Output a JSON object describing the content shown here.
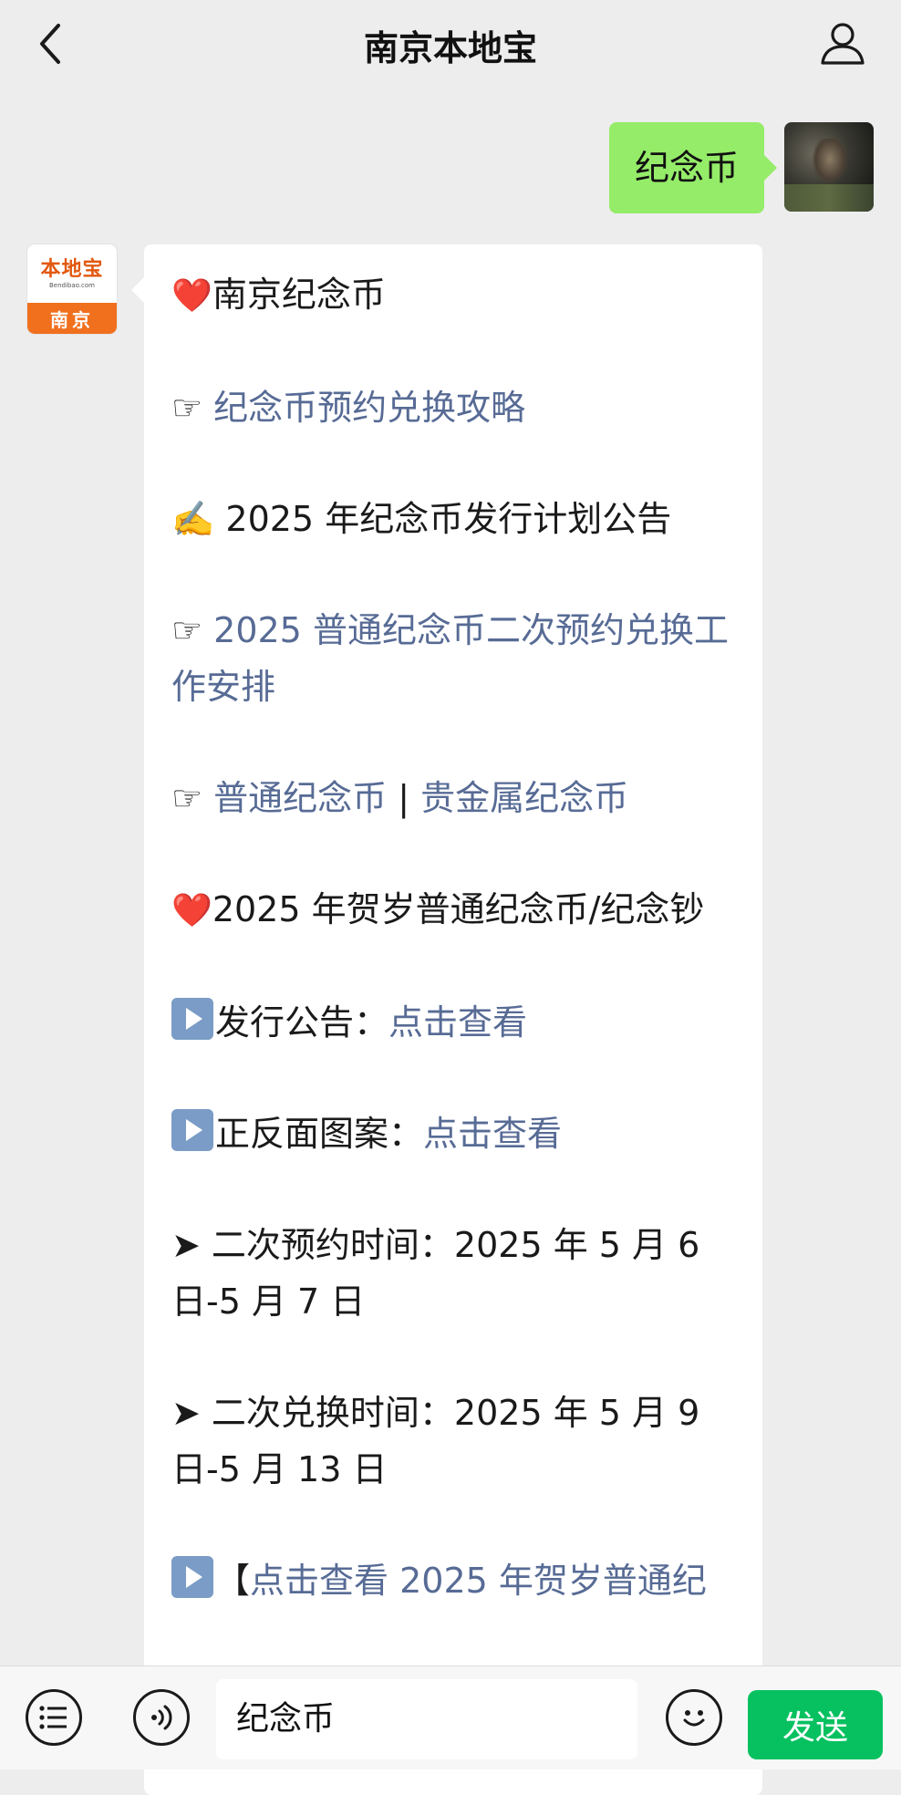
{
  "header": {
    "title": "南京本地宝"
  },
  "outgoing": {
    "text": "纪念币"
  },
  "bot": {
    "logo_main": "本地宝",
    "logo_sub": "Bendibao.com",
    "logo_city": "南京"
  },
  "messages": {
    "l1": {
      "emoji": "❤️",
      "text": "南京纪念币"
    },
    "l2": {
      "prefix": "☞ ",
      "link": "纪念币预约兑换攻略"
    },
    "l3": {
      "prefix": "✍️ ",
      "text": "2025 年纪念币发行计划公告"
    },
    "l4": {
      "prefix": "☞ ",
      "link": "2025 普通纪念币二次预约兑换工作安排"
    },
    "l5": {
      "prefix": "☞ ",
      "link_a": "普通纪念币",
      "sep": " | ",
      "link_b": "贵金属纪念币"
    },
    "l6": {
      "emoji": "❤️",
      "text": "2025 年贺岁普通纪念币/纪念钞"
    },
    "l7": {
      "text": "发行公告：",
      "link": "点击查看"
    },
    "l8": {
      "text": "正反面图案：",
      "link": "点击查看"
    },
    "l9": {
      "prefix": "➤ ",
      "text": "二次预约时间：2025 年 5 月 6 日-5 月 7 日"
    },
    "l10": {
      "prefix": "➤ ",
      "text": "二次兑换时间：2025 年 5 月 9 日-5 月 13 日"
    },
    "l11": {
      "bracket": "【",
      "link": "点击查看 2025 年贺岁普通纪"
    }
  },
  "input": {
    "value": "纪念币",
    "send_label": "发送"
  },
  "icons": {
    "back": "chevron-left-icon",
    "profile": "person-icon",
    "menu": "list-icon",
    "voice": "voice-icon",
    "emoji": "smiley-icon"
  },
  "colors": {
    "bubble_out": "#95ec69",
    "link": "#576b95",
    "send": "#07c160",
    "logo": "#f0701e"
  }
}
